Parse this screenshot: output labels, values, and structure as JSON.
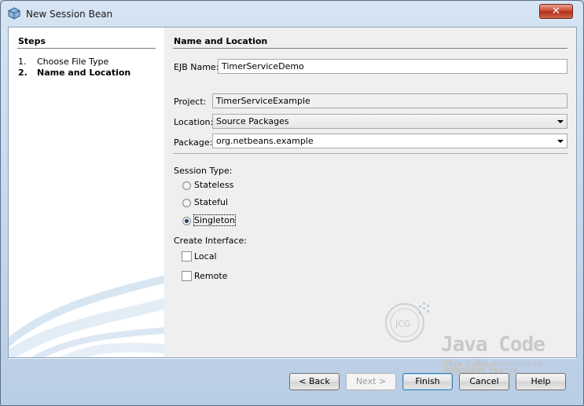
{
  "window": {
    "title": "New Session Bean",
    "close_label": "✕"
  },
  "steps": {
    "title": "Steps",
    "items": [
      {
        "num": "1.",
        "label": "Choose File Type",
        "active": false
      },
      {
        "num": "2.",
        "label": "Name and Location",
        "active": true
      }
    ]
  },
  "form": {
    "title": "Name and Location",
    "ejb_name": {
      "label": "EJB Name:",
      "value": "TimerServiceDemo"
    },
    "project": {
      "label": "Project:",
      "value": "TimerServiceExample"
    },
    "location": {
      "label": "Location:",
      "value": "Source Packages"
    },
    "package": {
      "label": "Package:",
      "value": "org.netbeans.example"
    },
    "session_type": {
      "label": "Session Type:",
      "options": [
        {
          "label": "Stateless",
          "checked": false
        },
        {
          "label": "Stateful",
          "checked": false
        },
        {
          "label": "Singleton",
          "checked": true
        }
      ]
    },
    "create_interface": {
      "label": "Create Interface:",
      "options": [
        {
          "label": "Local",
          "checked": false
        },
        {
          "label": "Remote",
          "checked": false
        }
      ]
    }
  },
  "buttons": {
    "back": "< Back",
    "next": "Next >",
    "finish": "Finish",
    "cancel": "Cancel",
    "help": "Help"
  },
  "watermark": {
    "text": "Java Code Geeks",
    "subtext": "JAVA 2 JAVA DEVELOPERS RESOURCE CENTER",
    "badge": "JCG"
  }
}
